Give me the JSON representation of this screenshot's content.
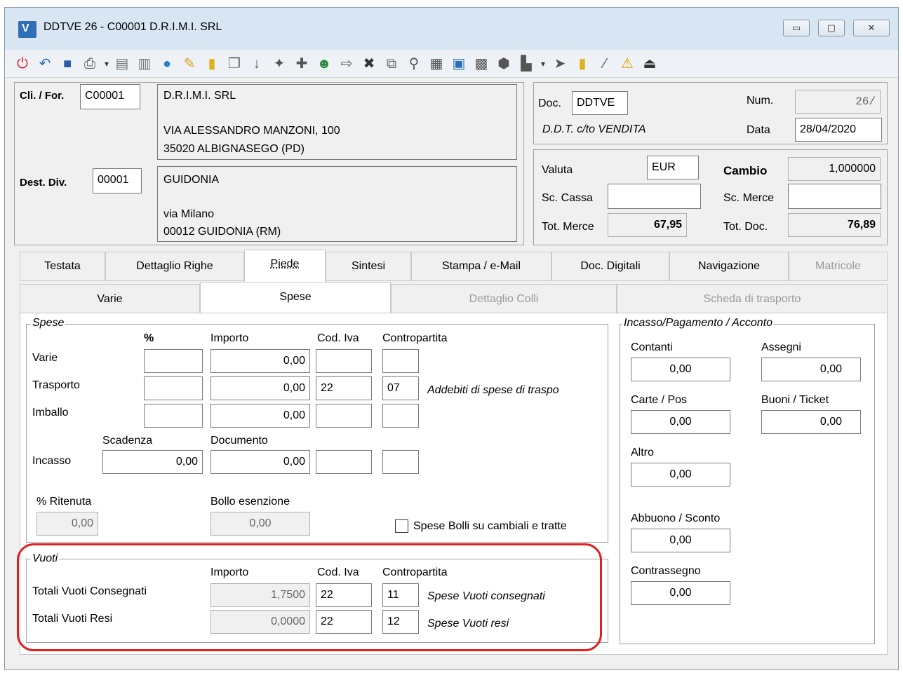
{
  "window": {
    "title": "DDTVE 26 - C00001 D.R.I.M.I. SRL",
    "app_icon": "V"
  },
  "window_buttons": {
    "minimize": "▭",
    "maximize": "▢",
    "close": "✕"
  },
  "toolbar_icons": [
    "power-icon",
    "undo-icon",
    "save-icon",
    "print-icon",
    "dropdown-icon",
    "document-icon",
    "preview-icon",
    "globe-icon",
    "open-icon",
    "folder-icon",
    "copy-icon",
    "down-arrow-icon",
    "tool-icon",
    "puzzle-icon",
    "user-icon",
    "export-icon",
    "delete-icon",
    "duplicate-icon",
    "search-icon",
    "barcode-icon",
    "notes-icon",
    "stamp-icon",
    "circle-icon",
    "block-icon",
    "dropdown-icon",
    "arrow-icon",
    "folder-icon",
    "pen-icon",
    "warning-icon",
    "exit-icon"
  ],
  "header": {
    "cli_label": "Cli. / For.",
    "cli_code": "C00001",
    "cli_name": "D.R.I.M.I. SRL",
    "cli_addr1": "VIA ALESSANDRO MANZONI, 100",
    "cli_addr2": "35020 ALBIGNASEGO (PD)",
    "dest_label": "Dest. Div.",
    "dest_code": "00001",
    "dest_name": "GUIDONIA",
    "dest_addr1": "via Milano",
    "dest_addr2": "00012 GUIDONIA (RM)",
    "doc_label": "Doc.",
    "doc_code": "DDTVE",
    "doc_desc": "D.D.T. c/to VENDITA",
    "num_label": "Num.",
    "num_value": "26/",
    "data_label": "Data",
    "data_value": "28/04/2020",
    "valuta_label": "Valuta",
    "valuta_value": "EUR",
    "cambio_label": "Cambio",
    "cambio_value": "1,000000",
    "sc_cassa_label": "Sc. Cassa",
    "sc_cassa_value": "",
    "sc_merce_label": "Sc. Merce",
    "sc_merce_value": "",
    "tot_merce_label": "Tot. Merce",
    "tot_merce_value": "67,95",
    "tot_doc_label": "Tot. Doc.",
    "tot_doc_value": "76,89"
  },
  "tabs": [
    "Testata",
    "Dettaglio Righe",
    "Piede",
    "Sintesi",
    "Stampa / e-Mail",
    "Doc. Digitali",
    "Navigazione",
    "Matricole"
  ],
  "subtabs": [
    "Varie",
    "Spese",
    "Dettaglio Colli",
    "Scheda di trasporto"
  ],
  "spese": {
    "title": "Spese",
    "col_pct": "%",
    "col_importo": "Importo",
    "col_iva": "Cod. Iva",
    "col_contro": "Contropartita",
    "rows": [
      {
        "label": "Varie",
        "pct": "",
        "importo": "0,00",
        "iva": "",
        "contro": "",
        "desc": ""
      },
      {
        "label": "Trasporto",
        "pct": "",
        "importo": "0,00",
        "iva": "22",
        "contro": "07",
        "desc": "Addebiti di spese di traspo"
      },
      {
        "label": "Imballo",
        "pct": "",
        "importo": "0,00",
        "iva": "",
        "contro": "",
        "desc": ""
      }
    ],
    "scadenza_label": "Scadenza",
    "documento_label": "Documento",
    "incasso_label": "Incasso",
    "incasso_scadenza": "0,00",
    "incasso_documento": "0,00",
    "incasso_iva": "",
    "incasso_contro": "",
    "ritenuta_label": "% Ritenuta",
    "ritenuta_value": "0,00",
    "bollo_label": "Bollo esenzione",
    "bollo_value": "0,00",
    "bolli_checkbox_label": "Spese Bolli su cambiali e tratte",
    "bolli_checked": false
  },
  "vuoti": {
    "title": "Vuoti",
    "col_importo": "Importo",
    "col_iva": "Cod. Iva",
    "col_contro": "Contropartita",
    "rows": [
      {
        "label": "Totali Vuoti Consegnati",
        "importo": "1,7500",
        "iva": "22",
        "contro": "11",
        "desc": "Spese Vuoti consegnati"
      },
      {
        "label": "Totali Vuoti Resi",
        "importo": "0,0000",
        "iva": "22",
        "contro": "12",
        "desc": "Spese Vuoti resi"
      }
    ],
    "highlight_color": "#e02020"
  },
  "incasso": {
    "title": "Incasso/Pagamento / Acconto",
    "contanti_label": "Contanti",
    "contanti_value": "0,00",
    "assegni_label": "Assegni",
    "assegni_value": "0,00",
    "carte_label": "Carte / Pos",
    "carte_value": "0,00",
    "buoni_label": "Buoni / Ticket",
    "buoni_value": "0,00",
    "altro_label": "Altro",
    "altro_value": "0,00",
    "abbuono_label": "Abbuono / Sconto",
    "abbuono_value": "0,00",
    "contrassegno_label": "Contrassegno",
    "contrassegno_value": "0,00"
  }
}
